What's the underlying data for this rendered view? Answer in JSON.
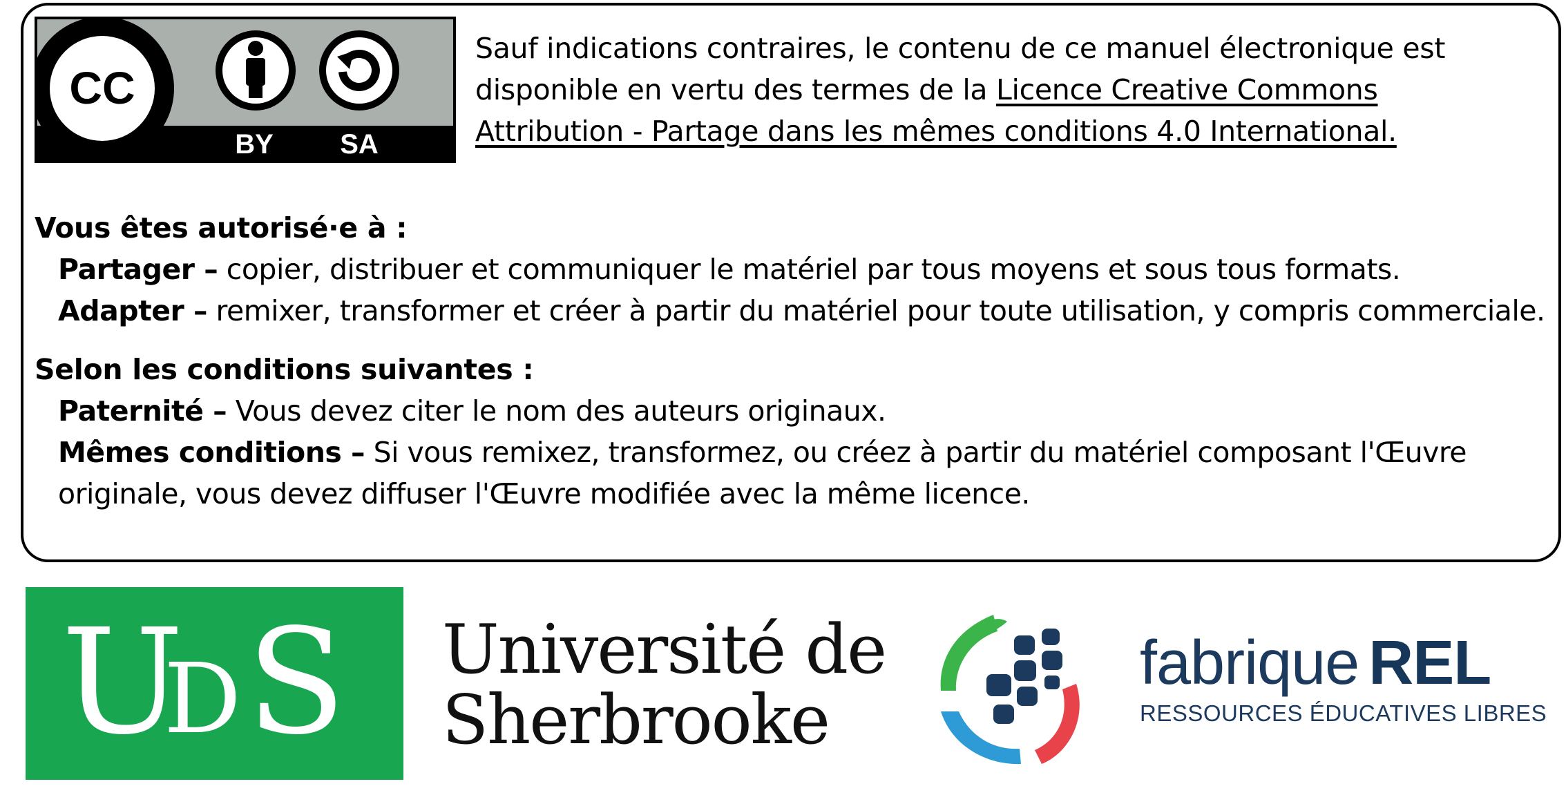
{
  "notice": {
    "text_prefix": "Sauf indications contraires, le contenu de ce manuel électronique est disponible en vertu des termes de la ",
    "link_label": "Licence Creative Commons Attribution - Partage dans les mêmes conditions 4.0 International."
  },
  "cc_badge": {
    "by_label": "BY",
    "sa_label": "SA",
    "cc_label": "CC"
  },
  "permissions": {
    "title": "Vous êtes autorisé·e à :",
    "items": [
      {
        "term": "Partager –",
        "text": " copier, distribuer et communiquer le matériel par tous moyens et sous tous formats."
      },
      {
        "term": "Adapter –",
        "text": " remixer, transformer et créer à partir du matériel pour toute utilisation, y compris commerciale."
      }
    ]
  },
  "conditions": {
    "title": "Selon les conditions suivantes :",
    "items": [
      {
        "term": "Paternité –",
        "text": " Vous devez citer le nom des auteurs originaux."
      },
      {
        "term": "Mêmes conditions –",
        "text": " Si vous remixez, transformez, ou créez à partir du matériel composant l'Œuvre",
        "continuation": "originale, vous devez diffuser l'Œuvre modifiée avec la même licence."
      }
    ]
  },
  "footer": {
    "uds_letters": "UDS",
    "university_name": "Université de\nSherbrooke",
    "fabrique_light": "fabrique",
    "fabrique_bold": "REL",
    "fabrique_tagline": "RESSOURCES ÉDUCATIVES LIBRES"
  },
  "colors": {
    "uds_green": "#19a651",
    "rel_navy": "#1c3a5e",
    "rel_green": "#3bb54a",
    "rel_blue": "#2e9bd6",
    "rel_red": "#e8424b",
    "badge_grey": "#aab1ac"
  }
}
